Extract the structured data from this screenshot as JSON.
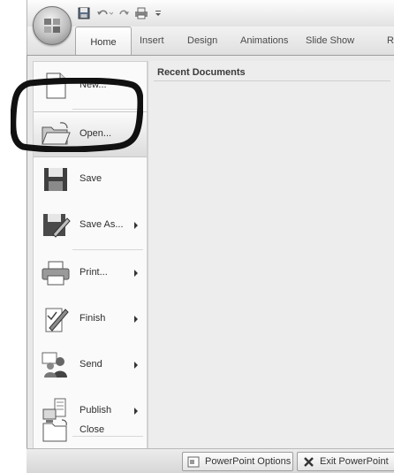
{
  "ribbon": {
    "tabs": [
      {
        "label": "Home"
      },
      {
        "label": "Insert"
      },
      {
        "label": "Design"
      },
      {
        "label": "Animations"
      },
      {
        "label": "Slide Show"
      },
      {
        "label": "R"
      }
    ],
    "active_tab": "Home"
  },
  "menu": {
    "recent_heading": "Recent Documents",
    "items": [
      {
        "label": "New...",
        "icon": "new-document-icon",
        "submenu": false
      },
      {
        "label": "Open...",
        "icon": "open-folder-icon",
        "submenu": false,
        "highlighted": true
      },
      {
        "label": "Save",
        "icon": "save-disk-icon",
        "submenu": false
      },
      {
        "label": "Save As...",
        "icon": "save-as-icon",
        "submenu": true
      },
      {
        "label": "Print...",
        "icon": "printer-icon",
        "submenu": true
      },
      {
        "label": "Finish",
        "icon": "finish-pen-icon",
        "submenu": true
      },
      {
        "label": "Send",
        "icon": "send-people-icon",
        "submenu": true
      },
      {
        "label": "Publish",
        "icon": "publish-server-icon",
        "submenu": true
      },
      {
        "label": "Close",
        "icon": "close-folder-icon",
        "submenu": false
      }
    ]
  },
  "footer": {
    "options_label": "PowerPoint Options",
    "exit_label": "Exit PowerPoint"
  },
  "colors": {
    "menu_bg": "#e9e9e9",
    "left_column": "#fafafa",
    "highlight_stroke": "#111111"
  }
}
